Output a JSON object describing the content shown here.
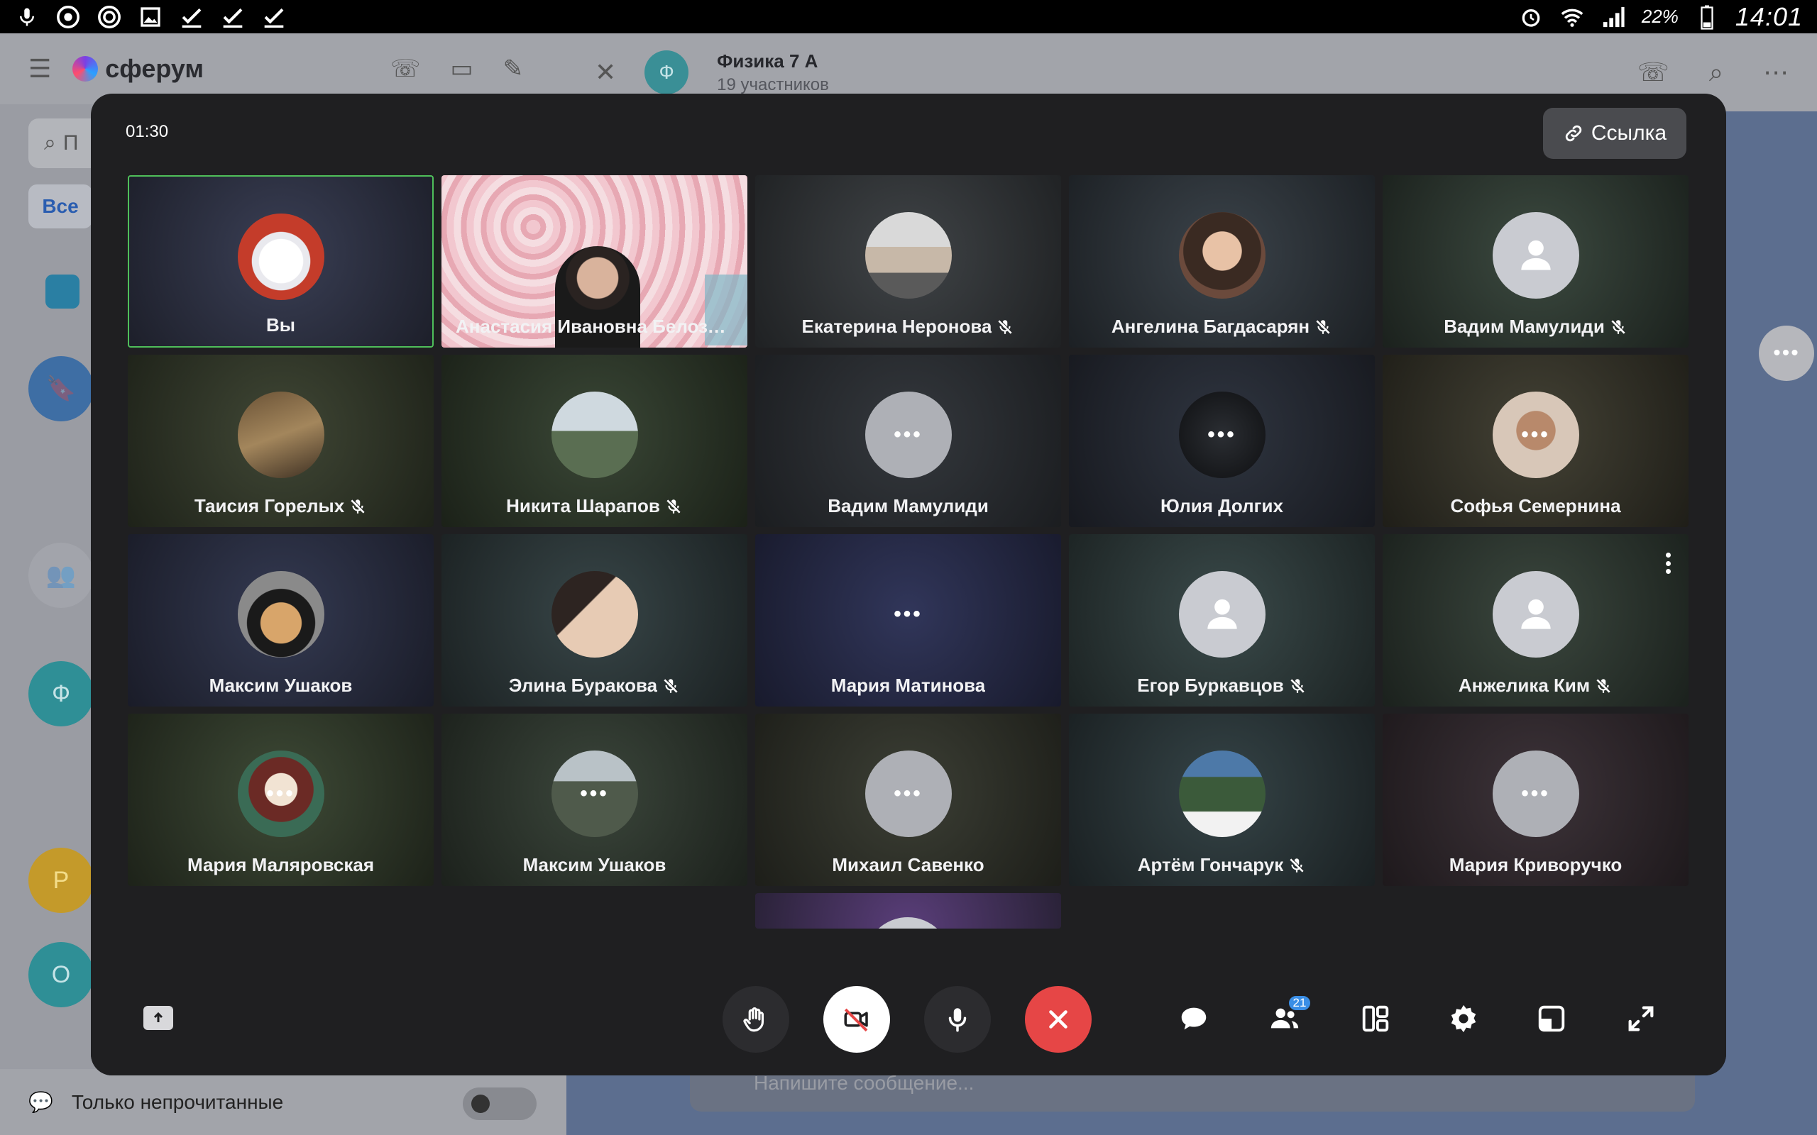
{
  "statusbar": {
    "battery": "22%",
    "time": "14:01"
  },
  "background": {
    "app_name": "сферум",
    "search_placeholder": "П",
    "filter_all": "Все",
    "chat_title": "Физика 7 А",
    "chat_subtitle": "19 участников",
    "chat_avatar_letter": "Ф",
    "list_letters": [
      "Ф",
      "Р",
      "О"
    ],
    "unread_only": "Только непрочитанные",
    "message_placeholder": "Напишите сообщение..."
  },
  "call": {
    "timer": "01:30",
    "link_label": "Ссылка",
    "participants_count": "21",
    "participants": [
      {
        "name": "Вы",
        "muted": false,
        "avatar": "cat-white",
        "self": true
      },
      {
        "name": "Анастасия Ивановна Белозер...",
        "muted": false,
        "avatar": "video"
      },
      {
        "name": "Екатерина Неронова",
        "muted": true,
        "avatar": "photo-cat"
      },
      {
        "name": "Ангелина Багдасарян",
        "muted": true,
        "avatar": "photo-girl"
      },
      {
        "name": "Вадим Мамулиди",
        "muted": true,
        "avatar": "placeholder"
      },
      {
        "name": "Таисия Горелых",
        "muted": true,
        "avatar": "photo-outdoor"
      },
      {
        "name": "Никита Шарапов",
        "muted": true,
        "avatar": "photo-waterfall"
      },
      {
        "name": "Вадим Мамулиди",
        "muted": false,
        "avatar": "placeholder-loading"
      },
      {
        "name": "Юлия Долгих",
        "muted": false,
        "avatar": "photo-dark-loading"
      },
      {
        "name": "Софья Семернина",
        "muted": false,
        "avatar": "photo-portrait-loading"
      },
      {
        "name": "Максим Ушаков",
        "muted": false,
        "avatar": "photo-cat-hat"
      },
      {
        "name": "Элина Буракова",
        "muted": true,
        "avatar": "photo-face"
      },
      {
        "name": "Мария Матинова",
        "muted": false,
        "avatar": "none-loading"
      },
      {
        "name": "Егор Буркавцов",
        "muted": true,
        "avatar": "placeholder"
      },
      {
        "name": "Анжелика Ким",
        "muted": true,
        "avatar": "placeholder",
        "menu": true
      },
      {
        "name": "Мария Маляровская",
        "muted": false,
        "avatar": "photo-anime-loading"
      },
      {
        "name": "Максим Ушаков",
        "muted": false,
        "avatar": "photo-forest-loading"
      },
      {
        "name": "Михаил Савенко",
        "muted": false,
        "avatar": "placeholder-loading"
      },
      {
        "name": "Артём Гончарук",
        "muted": true,
        "avatar": "photo-mountain"
      },
      {
        "name": "Мария Криворучко",
        "muted": false,
        "avatar": "placeholder-loading"
      },
      {
        "name": "",
        "muted": false,
        "avatar": "partial"
      }
    ]
  },
  "colors": {
    "self_border": "#4fbf5a",
    "end_call": "#e64646",
    "badge": "#3a8ee6"
  }
}
